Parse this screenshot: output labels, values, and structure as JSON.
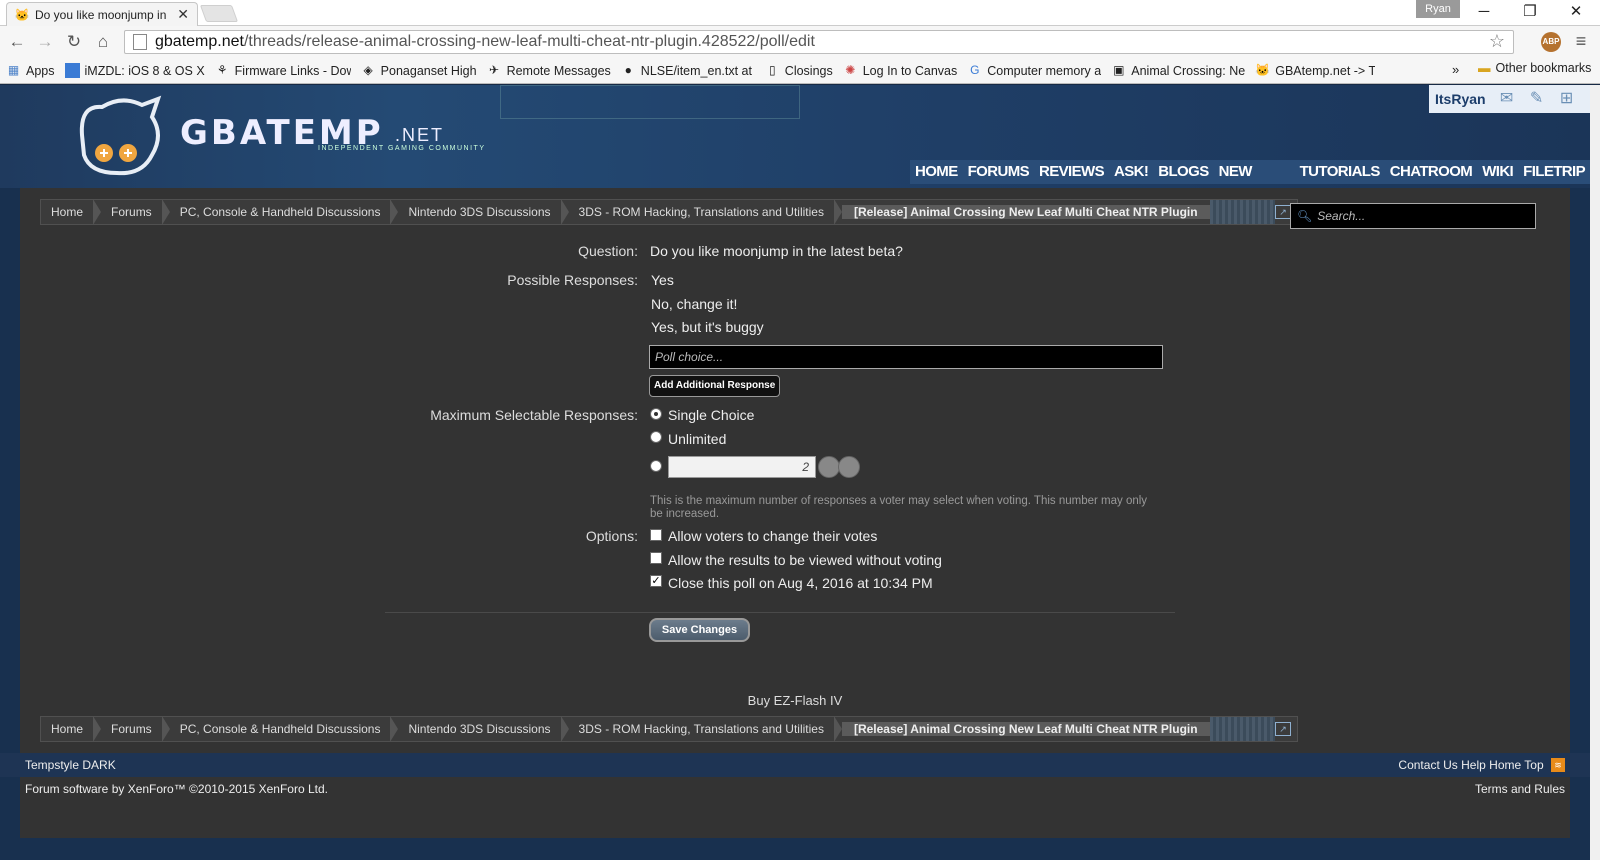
{
  "browser": {
    "tab_title": "Do you like moonjump in",
    "user_chip": "Ryan",
    "url_host": "gbatemp.net",
    "url_path": "/threads/release-animal-crossing-new-leaf-multi-cheat-ntr-plugin.428522/poll/edit",
    "abp_label": "ABP",
    "bookmarks": [
      {
        "label": "Apps",
        "icon": "apps-grid-icon"
      },
      {
        "label": "iMZDL: iOS 8 & OS X",
        "icon": "imzdl-icon"
      },
      {
        "label": "Firmware Links - Dow",
        "icon": "firmware-icon"
      },
      {
        "label": "Ponaganset High",
        "icon": "ponaganset-icon"
      },
      {
        "label": "Remote Messages",
        "icon": "plane-icon"
      },
      {
        "label": "NLSE/item_en.txt at m",
        "icon": "github-icon"
      },
      {
        "label": "Closings",
        "icon": "page-icon"
      },
      {
        "label": "Log In to Canvas",
        "icon": "canvas-icon"
      },
      {
        "label": "Computer memory an",
        "icon": "google-icon"
      },
      {
        "label": "Animal Crossing: New",
        "icon": "animal-crossing-icon"
      },
      {
        "label": "GBAtemp.net -> The",
        "icon": "gbatemp-icon"
      }
    ],
    "bookmarks_more": "»",
    "other_bookmarks": "Other bookmarks"
  },
  "site": {
    "logo_text": "GBATEMP",
    "logo_net": ".NET",
    "logo_sub": "INDEPENDENT GAMING COMMUNITY",
    "username": "ItsRyan",
    "nav": [
      "HOME",
      "FORUMS",
      "REVIEWS",
      "ASK!",
      "BLOGS",
      "NEW CONTENT",
      "TUTORIALS",
      "CHATROOM",
      "WIKI",
      "FILETRIP"
    ],
    "breadcrumbs": [
      "Home",
      "Forums",
      "PC, Console & Handheld Discussions",
      "Nintendo 3DS Discussions",
      "3DS - ROM Hacking, Translations and Utilities"
    ],
    "breadcrumb_current": "[Release] Animal Crossing New Leaf Multi Cheat NTR Plugin",
    "search_placeholder": "Search..."
  },
  "form": {
    "question_label": "Question:",
    "question_value": "Do you like moonjump in the latest beta?",
    "responses_label": "Possible Responses:",
    "responses": [
      "Yes",
      "No, change it!",
      "Yes, but it's buggy"
    ],
    "poll_choice_placeholder": "Poll choice...",
    "add_response_button": "Add Additional Response",
    "max_label": "Maximum Selectable Responses:",
    "single_choice": "Single Choice",
    "unlimited": "Unlimited",
    "max_number": "2",
    "hint": "This is the maximum number of responses a voter may select when voting. This number may only be increased.",
    "options_label": "Options:",
    "options": [
      {
        "label": "Allow voters to change their votes",
        "checked": false
      },
      {
        "label": "Allow the results to be viewed without voting",
        "checked": false
      },
      {
        "label": "Close this poll on Aug 4, 2016 at 10:34 PM",
        "checked": true
      }
    ],
    "save_button": "Save Changes"
  },
  "promo": "Buy EZ-Flash IV",
  "footer": {
    "style": "Tempstyle DARK",
    "links": [
      "Contact Us",
      "Help",
      "Home",
      "Top"
    ],
    "copyright": "Forum software by XenForo™ ©2010-2015 XenForo Ltd.",
    "terms": "Terms and Rules"
  }
}
